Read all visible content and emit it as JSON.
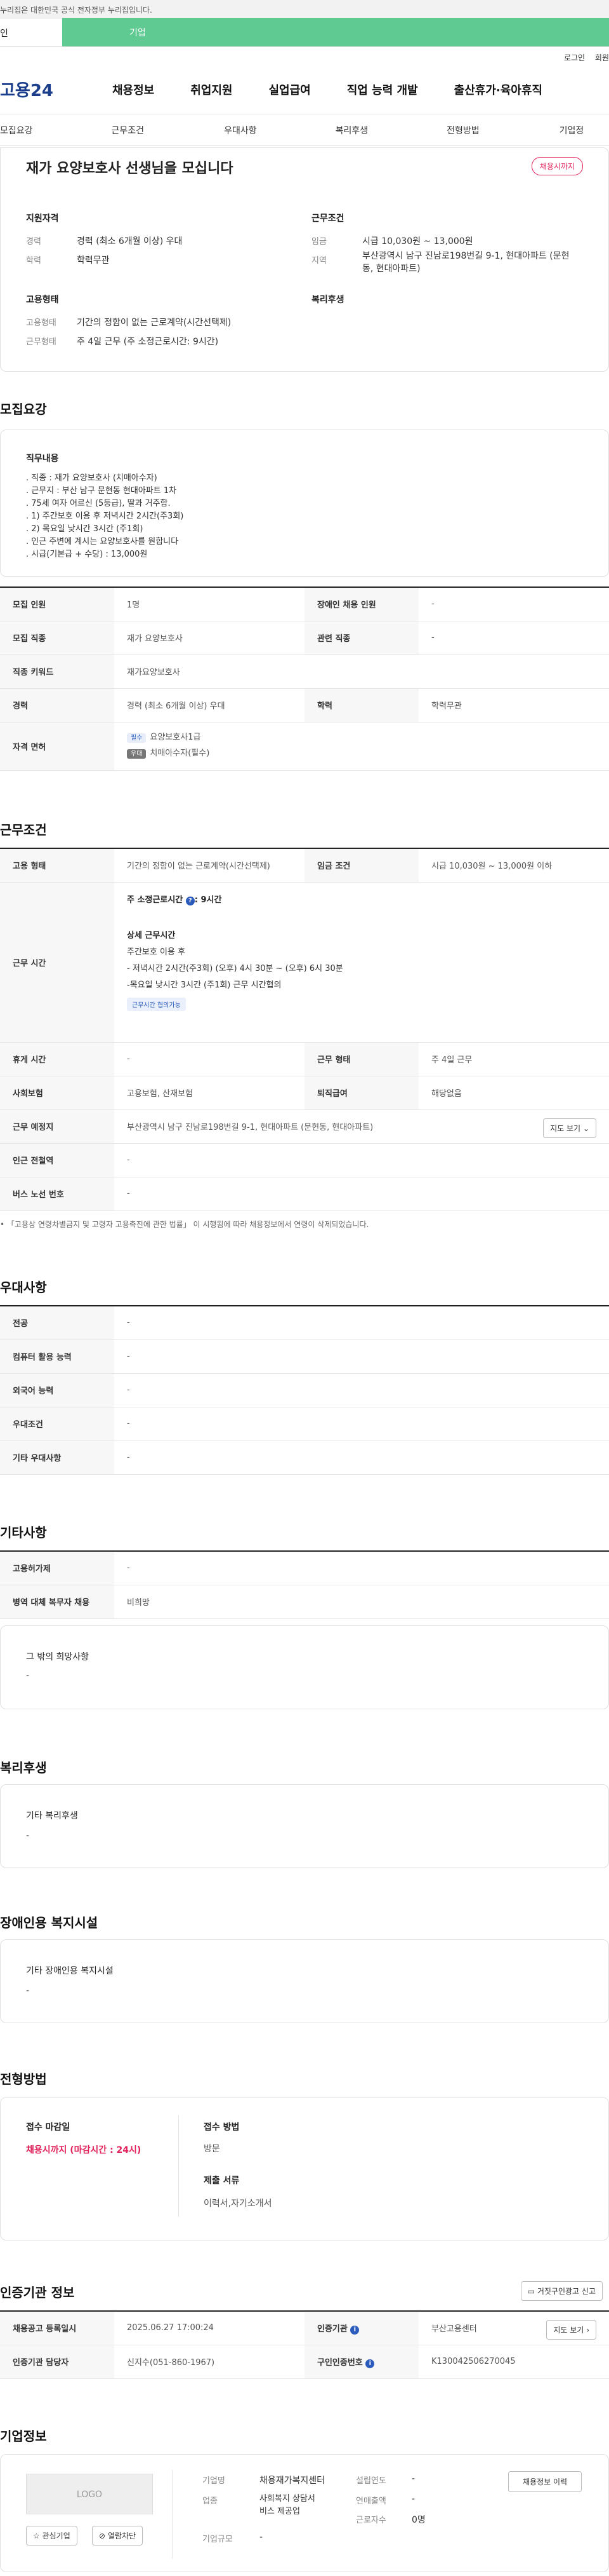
{
  "gov_notice": "누리집은 대한민국 공식 전자정부 누리집입니다.",
  "tabs": {
    "individual": "인",
    "corporate": "기업"
  },
  "util": {
    "login": "로그인",
    "join": "회원"
  },
  "logo": "고용24",
  "gnb": [
    "채용정보",
    "취업지원",
    "실업급여",
    "직업 능력 개발",
    "출산휴가·육아휴직"
  ],
  "subnav": [
    "모집요강",
    "근무조건",
    "우대사항",
    "복리후생",
    "전형방법",
    "기업정"
  ],
  "job": {
    "title": "재가 요양보호사 선생님을 모십니다",
    "deadline_badge": "채용시까지",
    "qualification_head": "지원자격",
    "career_lbl": "경력",
    "career_val": "경력 (최소 6개월 이상) 우대",
    "edu_lbl": "학력",
    "edu_val": "학력무관",
    "workcond_head": "근무조건",
    "wage_lbl": "임금",
    "wage_val": "시급 10,030원 ~ 13,000원",
    "region_lbl": "지역",
    "region_val": "부산광역시 남구 진남로198번길 9-1, 현대아파트 (문현동, 현대아파트)",
    "employ_head": "고용형태",
    "employ_lbl": "고용형태",
    "employ_val": "기간의 정함이 없는 근로계약(시간선택제)",
    "worktype_lbl": "근무형태",
    "worktype_val": "주 4일 근무 (주 소정근로시간: 9시간)",
    "welfare_head": "복리후생"
  },
  "recruit": {
    "section_title": "모집요강",
    "duty_head": "직무내용",
    "duty_text": ". 직종 : 재가 요양보호사 (치매아수자)\n. 근무지 : 부산 남구 문현동 현대아파트 1차\n. 75세 여자 어르신 (5등급), 딸과 거주함.\n. 1) 주간보호 이용 후 저녁시간 2시간(주3회)\n. 2) 목요일 낮시간 3시간 (주1회)\n. 인근 주변에 계시는 요양보호사를 원합니다\n. 시급(기본급 + 수당) : 13,000원",
    "rows": [
      {
        "l1": "모집 인원",
        "v1": "1명",
        "l2": "장애인 채용 인원",
        "v2": "-"
      },
      {
        "l1": "모집 직종",
        "v1": "재가 요양보호사",
        "l2": "관련 직종",
        "v2": "-"
      },
      {
        "l1": "직종 키워드",
        "v1": "재가요양보호사"
      },
      {
        "l1": "경력",
        "v1": "경력 (최소 6개월 이상) 우대",
        "l2": "학력",
        "v2": "학력무관"
      }
    ],
    "license_lbl": "자격 면허",
    "license_req_tag": "필수",
    "license_req": "요양보호사1급",
    "license_opt_tag": "우대",
    "license_opt": "치매아수자(필수)"
  },
  "workcond": {
    "section_title": "근무조건",
    "employ_lbl": "고용 형태",
    "employ_val": "기간의 정함이 없는 근로계약(시간선택제)",
    "wage_lbl": "임금 조건",
    "wage_val": "시급 10,030원 ~ 13,000원 이하",
    "hours_lbl": "근무 시간",
    "hours_head": "주 소정근로시간",
    "hours_val": ": 9시간",
    "detail_head": "상세 근무시간",
    "detail_text": "주간보호 이용 후\n- 저녁시간 2시간(주3회) (오후) 4시 30분 ~ (오후) 6시 30분\n-목요일 낮시간 3시간 (주1회) 근무 시간협의",
    "chip": "근무시간 협의가능",
    "rows2": [
      {
        "l1": "휴게 시간",
        "v1": "-",
        "l2": "근무 형태",
        "v2": "주 4일 근무"
      },
      {
        "l1": "사회보험",
        "v1": "고용보험, 산재보험",
        "l2": "퇴직급여",
        "v2": "해당없음"
      }
    ],
    "place_lbl": "근무 예정지",
    "place_val": "부산광역시 남구 진남로198번길 9-1, 현대아파트 (문현동, 현대아파트)",
    "map_btn": "지도 보기",
    "station_lbl": "인근 전철역",
    "station_val": "-",
    "bus_lbl": "버스 노선 번호",
    "bus_val": "-",
    "footnote": "「고용상 연령차별금지 및 고령자 고용촉진에 관한 법률」 이 시행됨에 따라 채용정보에서 연령이 삭제되었습니다."
  },
  "pref": {
    "section_title": "우대사항",
    "rows": [
      {
        "l": "전공",
        "v": "-"
      },
      {
        "l": "컴퓨터 활용 능력",
        "v": "-"
      },
      {
        "l": "외국어 능력",
        "v": "-"
      },
      {
        "l": "우대조건",
        "v": "-"
      },
      {
        "l": "기타 우대사항",
        "v": "-"
      }
    ]
  },
  "etc": {
    "section_title": "기타사항",
    "rows": [
      {
        "l": "고용허가제",
        "v": "-"
      },
      {
        "l": "병역 대체 복무자 채용",
        "v": "비희망"
      }
    ],
    "other_head": "그 밖의 희망사항",
    "other_val": "-"
  },
  "welfare": {
    "section_title": "복리후생",
    "head": "기타 복리후생",
    "val": "-"
  },
  "disabled": {
    "section_title": "장애인용 복지시설",
    "head": "기타 장애인용 복지시설",
    "val": "-"
  },
  "process": {
    "section_title": "전형방법",
    "deadline_head": "접수 마감일",
    "deadline_val": "채용시까지 (마감시간 : 24시)",
    "method_head": "접수 방법",
    "method_val": "방문",
    "docs_head": "제출 서류",
    "docs_val": "이력서,자기소개서"
  },
  "agency": {
    "section_title": "인증기관 정보",
    "report_btn": "거짓구인광고 신고",
    "reg_lbl": "채용공고 등록일시",
    "reg_val": "2025.06.27 17:00:24",
    "agency_lbl": "인증기관",
    "agency_val": "부산고용센터",
    "map_btn": "지도 보기",
    "staff_lbl": "인증기관 담당자",
    "staff_val": "신지수(051-860-1967)",
    "no_lbl": "구인인증번호",
    "no_val": "K130042506270045"
  },
  "company": {
    "section_title": "기업정보",
    "logo": "LOGO",
    "fav_btn": "관심기업",
    "block_btn": "열람차단",
    "name_lbl": "기업명",
    "name_val": "채용재가복지센터",
    "industry_lbl": "업종",
    "industry_val": "사회복지 상담서\n비스 제공업",
    "scale_lbl": "기업규모",
    "scale_val": "-",
    "found_lbl": "설립연도",
    "found_val": "-",
    "sales_lbl": "연매출액",
    "sales_val": "-",
    "staff_lbl": "근로자수",
    "staff_val": "0명",
    "history_btn": "채용정보 이력"
  }
}
